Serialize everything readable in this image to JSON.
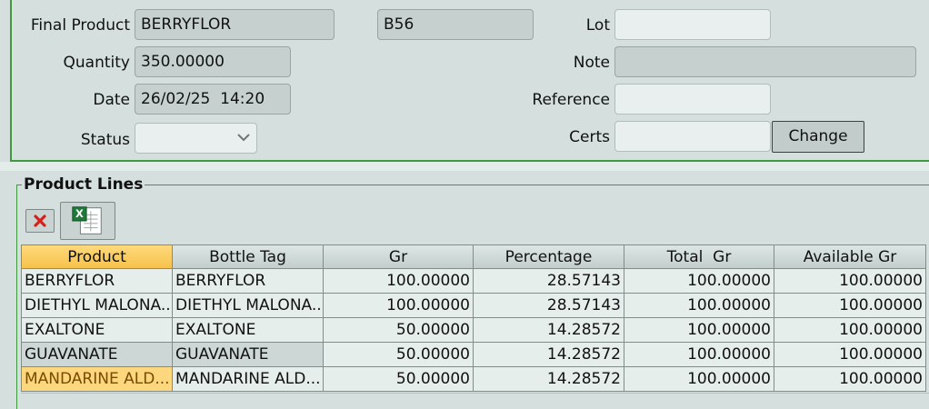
{
  "form": {
    "final_product_label": "Final Product",
    "final_product_value": "BERRYFLOR",
    "code_value": "B56",
    "lot_label": "Lot",
    "lot_value": "",
    "quantity_label": "Quantity",
    "quantity_value": "350.00000",
    "note_label": "Note",
    "note_value": "",
    "date_label": "Date",
    "date_value": "26/02/25  14:20",
    "reference_label": "Reference",
    "reference_value": "",
    "status_label": "Status",
    "status_value": "",
    "certs_label": "Certs",
    "certs_value": "",
    "change_button": "Change"
  },
  "product_lines": {
    "title": "Product Lines",
    "toolbar": [
      {
        "name": "delete-icon"
      },
      {
        "name": "excel-export-icon"
      }
    ],
    "columns": [
      "Product",
      "Bottle Tag",
      "Gr",
      "Percentage",
      "Total  Gr",
      "Available Gr"
    ],
    "sorted_column": "Product",
    "rows": [
      [
        "BERRYFLOR",
        "BERRYFLOR",
        "100.00000",
        "28.57143",
        "100.00000",
        "100.00000"
      ],
      [
        "DIETHYL MALONA...",
        "DIETHYL MALONA...",
        "100.00000",
        "28.57143",
        "100.00000",
        "100.00000"
      ],
      [
        "EXALTONE",
        "EXALTONE",
        "50.00000",
        "14.28572",
        "100.00000",
        "100.00000"
      ],
      [
        "GUAVANATE",
        "GUAVANATE",
        "50.00000",
        "14.28572",
        "100.00000",
        "100.00000"
      ],
      [
        "MANDARINE ALD...",
        "MANDARINE ALD...",
        "50.00000",
        "14.28572",
        "100.00000",
        "100.00000"
      ]
    ]
  },
  "colors": {
    "panel_border": "#3f9a3f",
    "sorted_header": "#f6c24c",
    "selected_cell": "#fcd77d",
    "background": "#d5e0de"
  }
}
